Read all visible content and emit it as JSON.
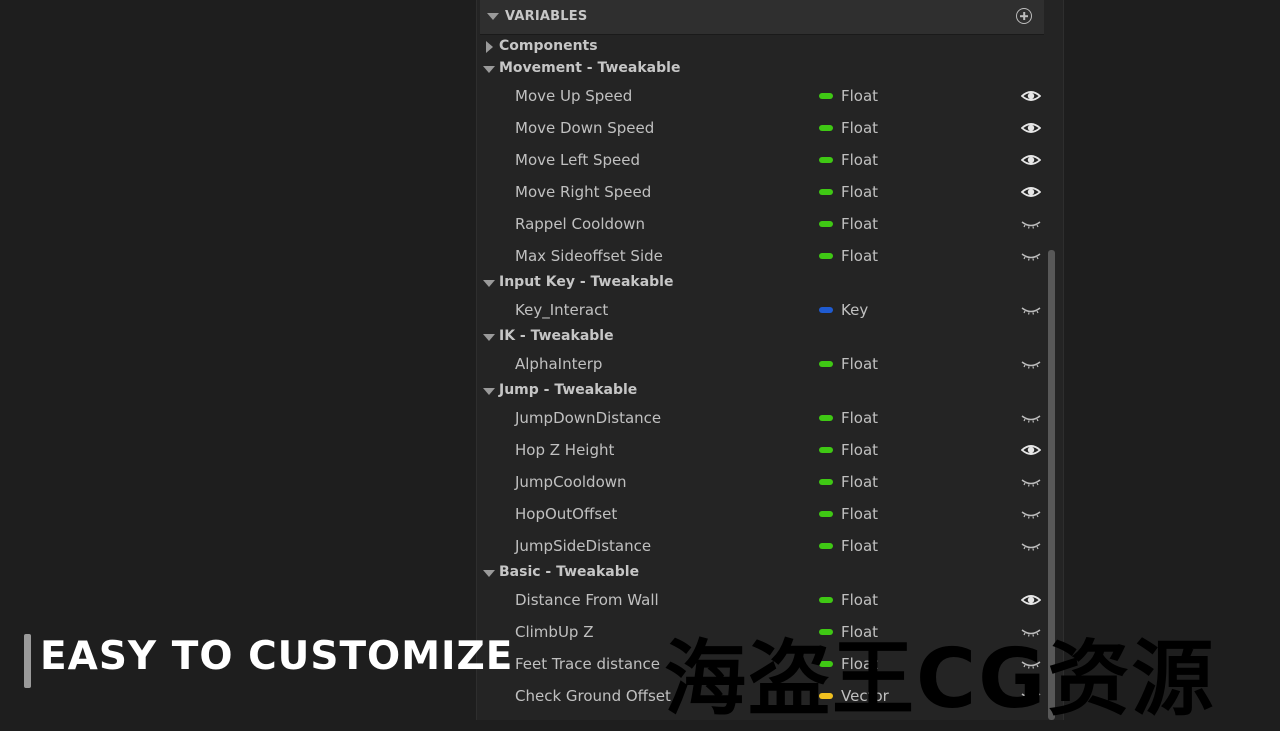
{
  "panel": {
    "title": "VARIABLES"
  },
  "colors": {
    "float": "#3fc814",
    "key": "#1f5bd1",
    "vector": "#f0c020",
    "panel_bg": "#242424",
    "header_bg": "#2f2f2f"
  },
  "categories": [
    {
      "label": "Components",
      "expanded": false,
      "vars": []
    },
    {
      "label": "Movement - Tweakable",
      "expanded": true,
      "vars": [
        {
          "name": "Move Up Speed",
          "type": "Float",
          "visible": true
        },
        {
          "name": "Move Down Speed",
          "type": "Float",
          "visible": true
        },
        {
          "name": "Move Left Speed",
          "type": "Float",
          "visible": true
        },
        {
          "name": "Move Right Speed",
          "type": "Float",
          "visible": true
        },
        {
          "name": "Rappel Cooldown",
          "type": "Float",
          "visible": false
        },
        {
          "name": "Max Sideoffset Side",
          "type": "Float",
          "visible": false
        }
      ]
    },
    {
      "label": "Input Key - Tweakable",
      "expanded": true,
      "vars": [
        {
          "name": "Key_Interact",
          "type": "Key",
          "visible": false
        }
      ]
    },
    {
      "label": "IK - Tweakable",
      "expanded": true,
      "vars": [
        {
          "name": "AlphaInterp",
          "type": "Float",
          "visible": false
        }
      ]
    },
    {
      "label": "Jump - Tweakable",
      "expanded": true,
      "vars": [
        {
          "name": "JumpDownDistance",
          "type": "Float",
          "visible": false
        },
        {
          "name": "Hop Z Height",
          "type": "Float",
          "visible": true
        },
        {
          "name": "JumpCooldown",
          "type": "Float",
          "visible": false
        },
        {
          "name": "HopOutOffset",
          "type": "Float",
          "visible": false
        },
        {
          "name": "JumpSideDistance",
          "type": "Float",
          "visible": false
        }
      ]
    },
    {
      "label": "Basic - Tweakable",
      "expanded": true,
      "vars": [
        {
          "name": "Distance From Wall",
          "type": "Float",
          "visible": true
        },
        {
          "name": "ClimbUp Z",
          "type": "Float",
          "visible": false
        },
        {
          "name": "Feet Trace distance",
          "type": "Float",
          "visible": false
        },
        {
          "name": "Check Ground Offset",
          "type": "Vector",
          "visible": false
        }
      ]
    }
  ],
  "overlay": {
    "badge": "EASY TO CUSTOMIZE",
    "watermark": "海盗王CG资源"
  }
}
